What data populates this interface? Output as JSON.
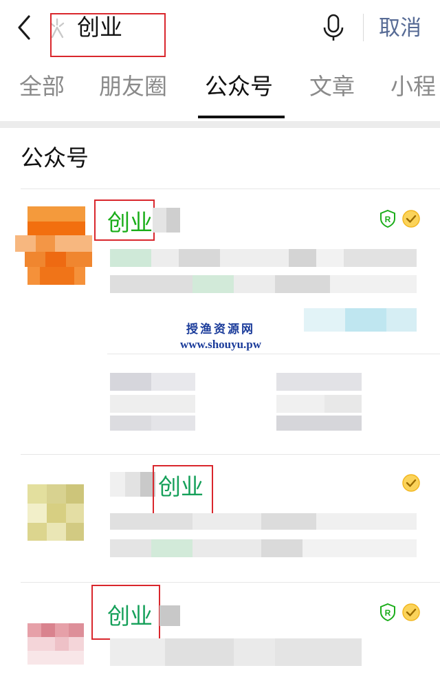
{
  "search": {
    "query": "创业",
    "cancel_label": "取消"
  },
  "tabs": [
    {
      "label": "全部",
      "active": false
    },
    {
      "label": "朋友圈",
      "active": false
    },
    {
      "label": "公众号",
      "active": true
    },
    {
      "label": "文章",
      "active": false
    },
    {
      "label": "小程",
      "active": false
    }
  ],
  "section": {
    "title": "公众号"
  },
  "results": [
    {
      "name": "创业",
      "badges": [
        "registered-r-icon",
        "verified-check-icon"
      ]
    },
    {
      "name": "创业",
      "badges": [
        "verified-check-icon"
      ]
    },
    {
      "name": "创业",
      "badges": [
        "registered-r-icon",
        "verified-check-icon"
      ]
    }
  ],
  "watermark": {
    "line1": "授渔资源网",
    "line2": "www.shouyu.pw"
  },
  "colors": {
    "accent_green": "#1aad19",
    "link_blue": "#576b95",
    "highlight_red": "#d9262c",
    "verified_yellow": "#f2b721"
  }
}
